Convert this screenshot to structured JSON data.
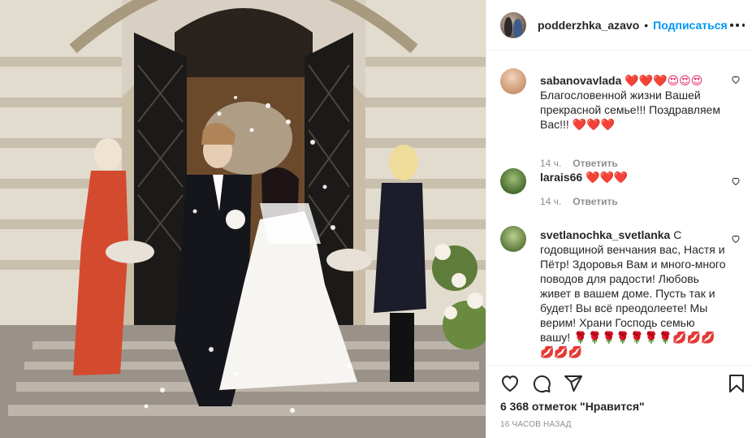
{
  "post": {
    "image_alt": "wedding photo",
    "username": "podderzhka_azavo",
    "dot": "•",
    "follow_label": "Подписаться"
  },
  "comments": [
    {
      "user": "sabanovavlada",
      "emojis": "❤️❤️❤️😍😍😍",
      "text": "Благословенной жизни Вашей прекрасной семье!!! Поздравляем Вас!!!",
      "text_emojis": "❤️❤️❤️",
      "time": "14 ч.",
      "reply": "Ответить"
    },
    {
      "user": "larais66",
      "emojis": "❤️❤️❤️",
      "time": "14 ч.",
      "reply": "Ответить"
    },
    {
      "user": "svetlanochka_svetlanka",
      "text": "С годовщиной венчания вас, Настя и Пётр! Здоровья Вам и много-много поводов для радости! Любовь живет в вашем доме. Пусть так и будет! Вы всё преодолеете! Мы верим! Храни Господь семью вашу!",
      "emojis": "🌹🌹🌹🌹🌹🌹🌹💋💋💋💋💋💋"
    }
  ],
  "actions": {
    "likes": "6 368 отметок \"Нравится\"",
    "time": "16 часов назад"
  },
  "colors": {
    "link_blue": "#0095f6",
    "text": "#262626",
    "muted": "#8e8e8e",
    "heart_red": "#e0245e"
  }
}
